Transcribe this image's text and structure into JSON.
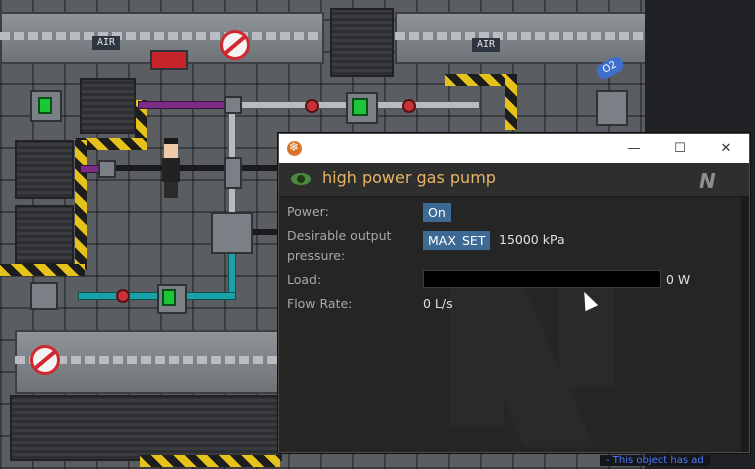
{
  "window": {
    "title": "high power gas pump",
    "buttons": {
      "minimize": "—",
      "maximize": "☐",
      "close": "✕"
    },
    "logo": "N"
  },
  "controls": {
    "power": {
      "label": "Power:",
      "button": "On"
    },
    "pressure": {
      "label_line1": "Desirable output",
      "label_line2": "pressure:",
      "max_button": "MAX",
      "set_button": "SET",
      "value": "15000 kPa"
    },
    "load": {
      "label": "Load:",
      "value": "0 W",
      "fraction": 0.0
    },
    "flow": {
      "label": "Flow Rate:",
      "value": "0 L/s"
    }
  },
  "game": {
    "sign_left": "AIR",
    "sign_right": "AIR",
    "canister_label": "O2"
  },
  "status_bar": {
    "text": "- This object has ad"
  },
  "colors": {
    "accent": "#e8b565",
    "button": "#3c6a94",
    "bg": "#252525"
  }
}
